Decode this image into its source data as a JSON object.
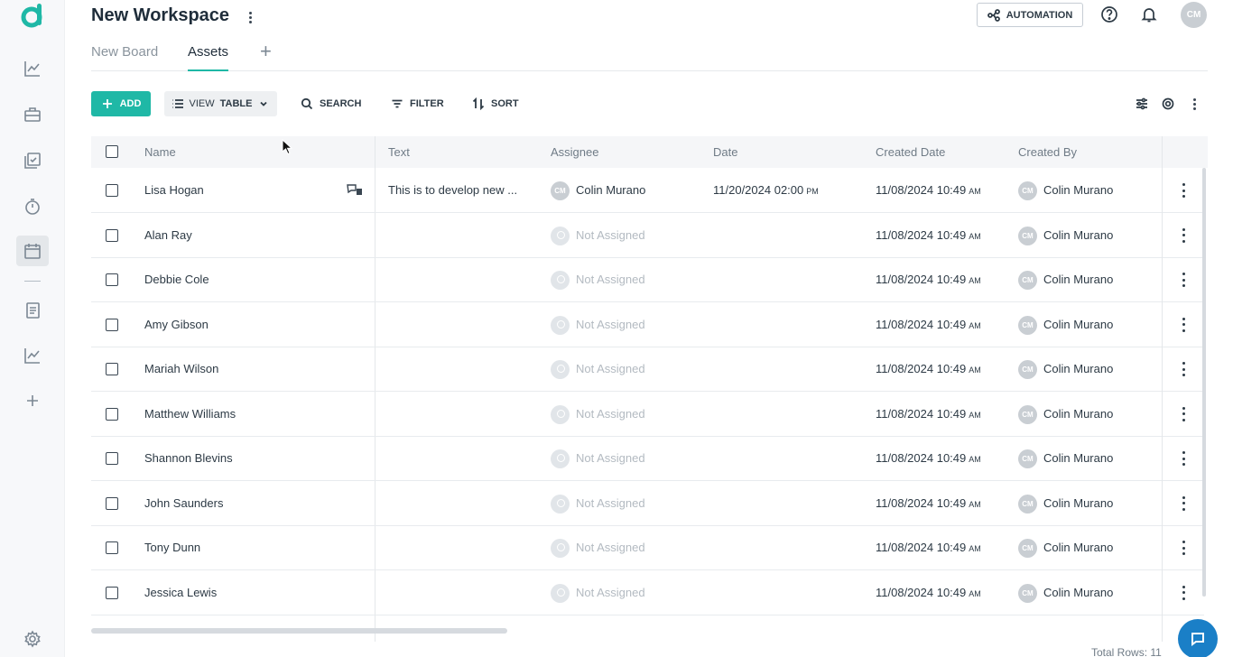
{
  "header": {
    "workspace_title": "New Workspace",
    "automation_label": "AUTOMATION",
    "avatar_initials": "CM"
  },
  "tabs": [
    {
      "label": "New Board",
      "active": false
    },
    {
      "label": "Assets",
      "active": true
    }
  ],
  "toolbar": {
    "add_label": "ADD",
    "view_prefix": "VIEW",
    "view_value": "TABLE",
    "search_label": "SEARCH",
    "filter_label": "FILTER",
    "sort_label": "SORT"
  },
  "table": {
    "columns": [
      "Name",
      "Text",
      "Assignee",
      "Date",
      "Created Date",
      "Created By"
    ],
    "rows": [
      {
        "name": "Lisa Hogan",
        "text": "This is to develop new ...",
        "assignee": "Colin Murano",
        "assignee_initials": "CM",
        "date": "11/20/2024 02:00",
        "date_ampm": "PM",
        "created_date": "11/08/2024 10:49",
        "created_ampm": "AM",
        "created_by": "Colin Murano",
        "created_by_initials": "CM"
      },
      {
        "name": "Alan Ray",
        "text": "",
        "assignee": "Not Assigned",
        "date": "",
        "date_ampm": "",
        "created_date": "11/08/2024 10:49",
        "created_ampm": "AM",
        "created_by": "Colin Murano",
        "created_by_initials": "CM"
      },
      {
        "name": "Debbie Cole",
        "text": "",
        "assignee": "Not Assigned",
        "date": "",
        "date_ampm": "",
        "created_date": "11/08/2024 10:49",
        "created_ampm": "AM",
        "created_by": "Colin Murano",
        "created_by_initials": "CM"
      },
      {
        "name": "Amy Gibson",
        "text": "",
        "assignee": "Not Assigned",
        "date": "",
        "date_ampm": "",
        "created_date": "11/08/2024 10:49",
        "created_ampm": "AM",
        "created_by": "Colin Murano",
        "created_by_initials": "CM"
      },
      {
        "name": "Mariah Wilson",
        "text": "",
        "assignee": "Not Assigned",
        "date": "",
        "date_ampm": "",
        "created_date": "11/08/2024 10:49",
        "created_ampm": "AM",
        "created_by": "Colin Murano",
        "created_by_initials": "CM"
      },
      {
        "name": "Matthew Williams",
        "text": "",
        "assignee": "Not Assigned",
        "date": "",
        "date_ampm": "",
        "created_date": "11/08/2024 10:49",
        "created_ampm": "AM",
        "created_by": "Colin Murano",
        "created_by_initials": "CM"
      },
      {
        "name": "Shannon Blevins",
        "text": "",
        "assignee": "Not Assigned",
        "date": "",
        "date_ampm": "",
        "created_date": "11/08/2024 10:49",
        "created_ampm": "AM",
        "created_by": "Colin Murano",
        "created_by_initials": "CM"
      },
      {
        "name": "John Saunders",
        "text": "",
        "assignee": "Not Assigned",
        "date": "",
        "date_ampm": "",
        "created_date": "11/08/2024 10:49",
        "created_ampm": "AM",
        "created_by": "Colin Murano",
        "created_by_initials": "CM"
      },
      {
        "name": "Tony Dunn",
        "text": "",
        "assignee": "Not Assigned",
        "date": "",
        "date_ampm": "",
        "created_date": "11/08/2024 10:49",
        "created_ampm": "AM",
        "created_by": "Colin Murano",
        "created_by_initials": "CM"
      },
      {
        "name": "Jessica Lewis",
        "text": "",
        "assignee": "Not Assigned",
        "date": "",
        "date_ampm": "",
        "created_date": "11/08/2024 10:49",
        "created_ampm": "AM",
        "created_by": "Colin Murano",
        "created_by_initials": "CM"
      }
    ]
  },
  "footer": {
    "total_rows": "Total Rows: 11"
  },
  "colors": {
    "accent": "#1fb8a6",
    "chat": "#1a7fc7"
  },
  "icons": {
    "sidebar": [
      "chart-line-icon",
      "briefcase-icon",
      "checklist-icon",
      "timer-icon",
      "calendar-icon",
      "document-icon",
      "chart-line-icon",
      "plus-icon",
      "gear-icon"
    ],
    "header": [
      "help-icon",
      "bell-icon"
    ]
  }
}
